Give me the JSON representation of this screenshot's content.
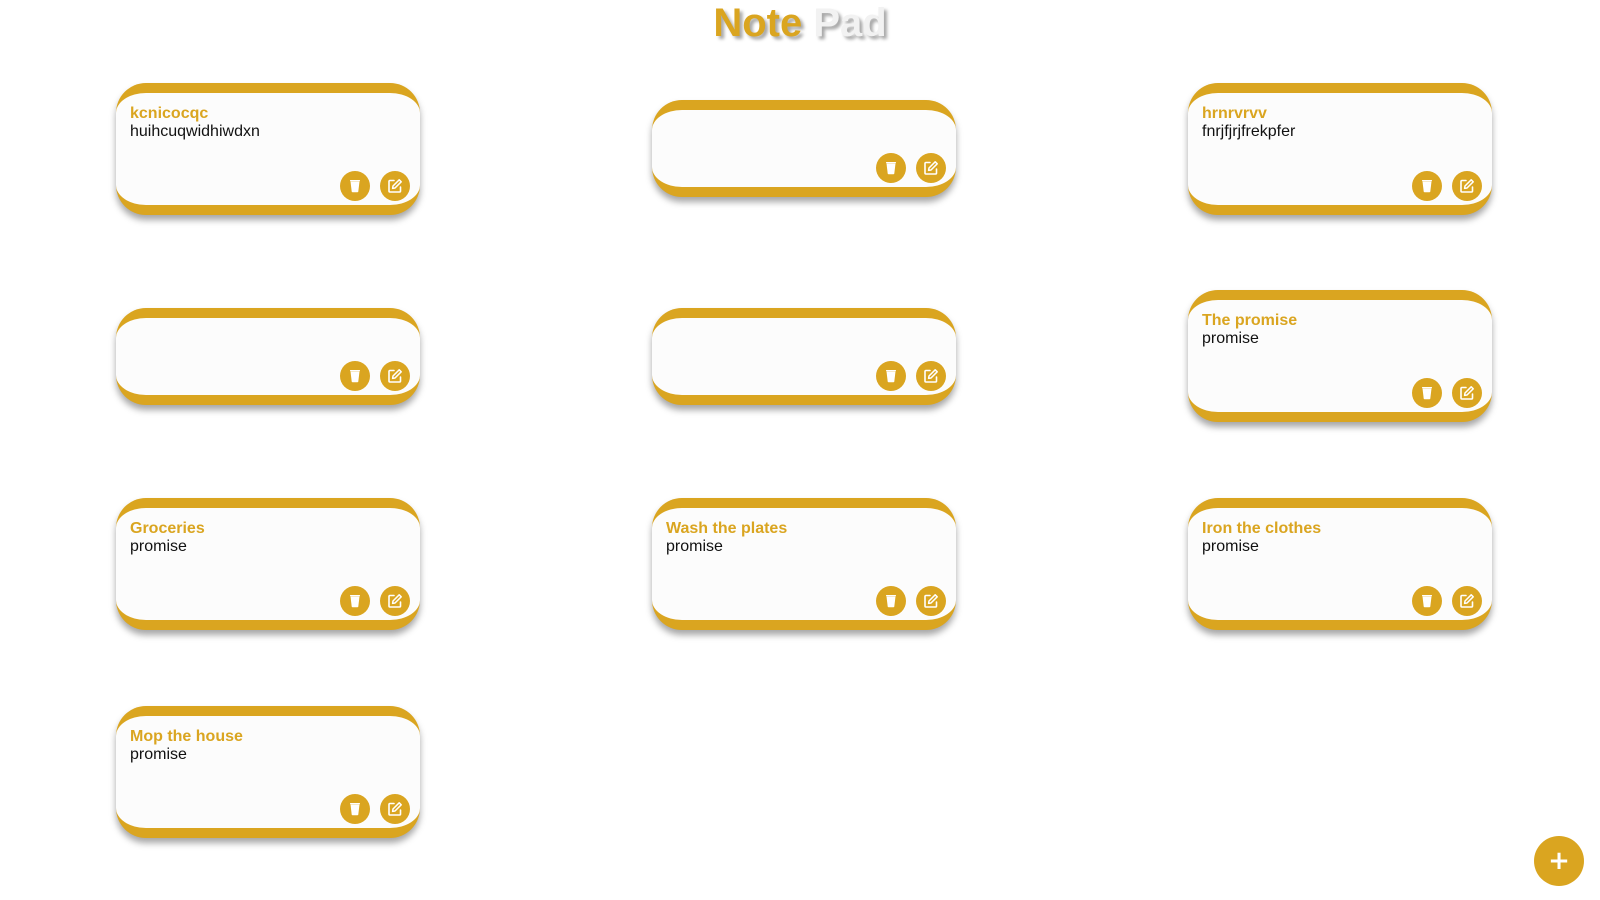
{
  "app": {
    "title_part1": "Note",
    "title_part2": "Pad",
    "accent_color": "#DAA520"
  },
  "notes": [
    {
      "title": "kcnicocqc",
      "body": "huihcuqwidhiwdxn"
    },
    {
      "title": "",
      "body": ""
    },
    {
      "title": "hrnrvrvv",
      "body": "fnrjfjrjfrekpfer"
    },
    {
      "title": "",
      "body": ""
    },
    {
      "title": "",
      "body": ""
    },
    {
      "title": "The promise",
      "body": "promise"
    },
    {
      "title": "Groceries",
      "body": "promise"
    },
    {
      "title": "Wash the plates",
      "body": "promise"
    },
    {
      "title": "Iron the clothes",
      "body": "promise"
    },
    {
      "title": "Mop the house",
      "body": "promise"
    }
  ],
  "icons": {
    "delete": "trash-icon",
    "edit": "edit-icon"
  },
  "add_button": {
    "label": "+"
  }
}
